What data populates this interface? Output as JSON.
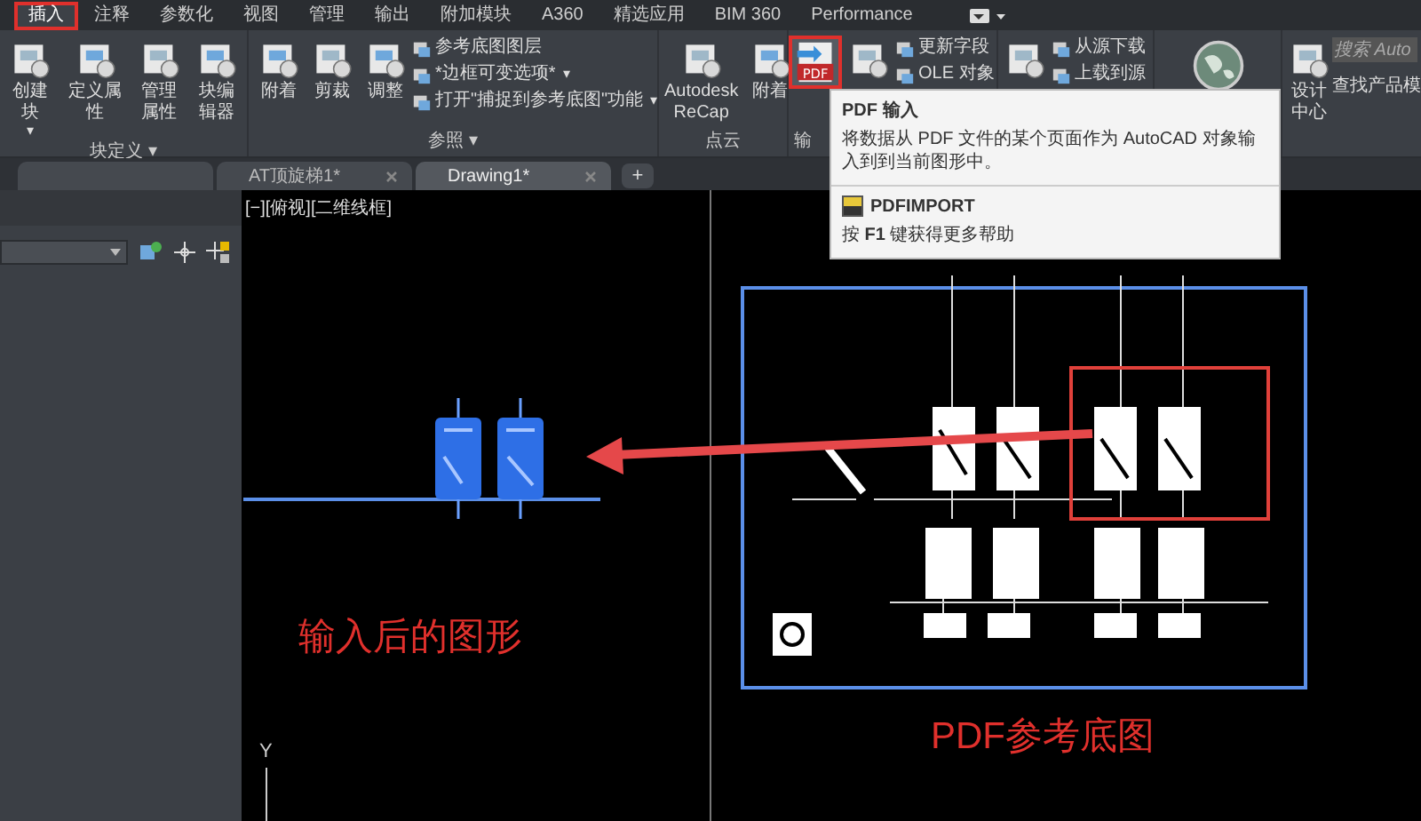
{
  "ribbon_tabs": [
    {
      "label": "插入",
      "selected": true,
      "highlighted": true
    },
    {
      "label": "注释",
      "selected": false,
      "highlighted": false
    },
    {
      "label": "参数化",
      "selected": false,
      "highlighted": false
    },
    {
      "label": "视图",
      "selected": false,
      "highlighted": false
    },
    {
      "label": "管理",
      "selected": false,
      "highlighted": false
    },
    {
      "label": "输出",
      "selected": false,
      "highlighted": false
    },
    {
      "label": "附加模块",
      "selected": false,
      "highlighted": false
    },
    {
      "label": "A360",
      "selected": false,
      "highlighted": false
    },
    {
      "label": "精选应用",
      "selected": false,
      "highlighted": false
    },
    {
      "label": "BIM 360",
      "selected": false,
      "highlighted": false
    },
    {
      "label": "Performance",
      "selected": false,
      "highlighted": false
    }
  ],
  "ribbon_panels": [
    {
      "title": "块定义 ▾",
      "buttons": [
        {
          "kind": "large",
          "label": "创建块",
          "caret": "▾"
        },
        {
          "kind": "large",
          "label": "定义属性"
        },
        {
          "kind": "large",
          "label": "管理属性"
        },
        {
          "kind": "large",
          "label": "块编辑器"
        }
      ]
    },
    {
      "title": "参照 ▾",
      "buttons": [
        {
          "kind": "large",
          "label": "附着"
        },
        {
          "kind": "large",
          "label": "剪裁"
        },
        {
          "kind": "large",
          "label": "调整"
        },
        {
          "kind": "small",
          "label": "参考底图图层"
        },
        {
          "kind": "small",
          "label": "*边框可变选项*",
          "caret": "▾"
        },
        {
          "kind": "small",
          "label": "打开\"捕捉到参考底图\"功能",
          "caret": "▾"
        }
      ]
    },
    {
      "title": "点云",
      "buttons": [
        {
          "kind": "large",
          "label": "Autodesk ReCap"
        },
        {
          "kind": "large",
          "label": "附着"
        }
      ]
    },
    {
      "title": "输",
      "buttons": [
        {
          "kind": "pdf",
          "label": "PDF"
        },
        {
          "kind": "large"
        },
        {
          "kind": "small",
          "label": "更新字段"
        },
        {
          "kind": "small",
          "label": "OLE 对象"
        }
      ]
    },
    {
      "buttons": [
        {
          "kind": "large"
        },
        {
          "kind": "small",
          "label": "从源下载"
        },
        {
          "kind": "small",
          "label": "上载到源"
        }
      ]
    },
    {
      "buttons": [
        {
          "kind": "globe"
        }
      ]
    },
    {
      "buttons": [
        {
          "kind": "large",
          "label": "设计中心"
        }
      ]
    }
  ],
  "search": {
    "placeholder": "搜索 Auto",
    "label": "查找产品模"
  },
  "tooltip": {
    "title": "PDF 输入",
    "description": "将数据从 PDF 文件的某个页面作为 AutoCAD 对象输入到到当前图形中。",
    "command": "PDFIMPORT",
    "help": "按 **F1** 键获得更多帮助"
  },
  "file_tabs": [
    {
      "selected": false
    },
    {
      "label": "AT顶旋梯1*",
      "selected": false
    },
    {
      "label": "Drawing1*",
      "selected": true
    }
  ],
  "new_tab": "+",
  "viewport_label": "[−][俯视][二维线框]",
  "annotations": [
    "输入后的图形",
    "PDF参考底图"
  ],
  "axis_label": "Y"
}
